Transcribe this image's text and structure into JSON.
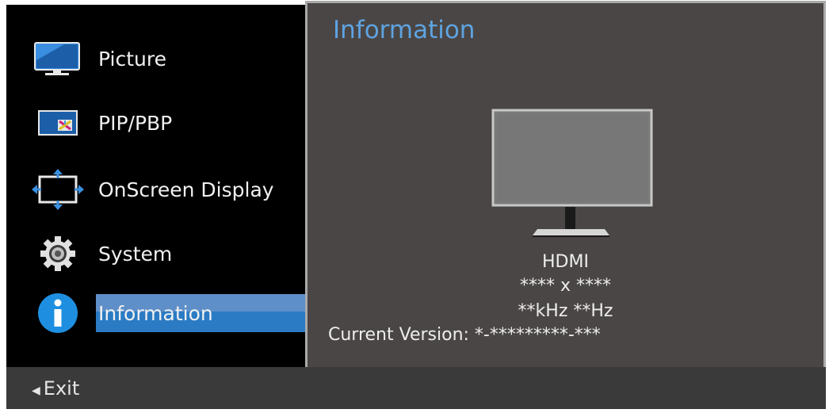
{
  "menu": {
    "items": [
      {
        "label": "Picture",
        "icon": "monitor-icon"
      },
      {
        "label": "PIP/PBP",
        "icon": "pip-pbp-icon"
      },
      {
        "label": "OnScreen Display",
        "icon": "onscreen-display-icon"
      },
      {
        "label": "System",
        "icon": "gear-icon"
      },
      {
        "label": "Information",
        "icon": "info-icon",
        "selected": true
      }
    ]
  },
  "panel": {
    "title": "Information",
    "source": "HDMI",
    "resolution": "**** x ****",
    "frequency": "**kHz **Hz",
    "version": "Current Version: *-*********-***"
  },
  "footer": {
    "exit_label": "Exit"
  },
  "colors": {
    "accent": "#2b7bc4",
    "title": "#5ea3e0",
    "panel_bg": "#4a4645",
    "menu_bg": "#000000"
  }
}
